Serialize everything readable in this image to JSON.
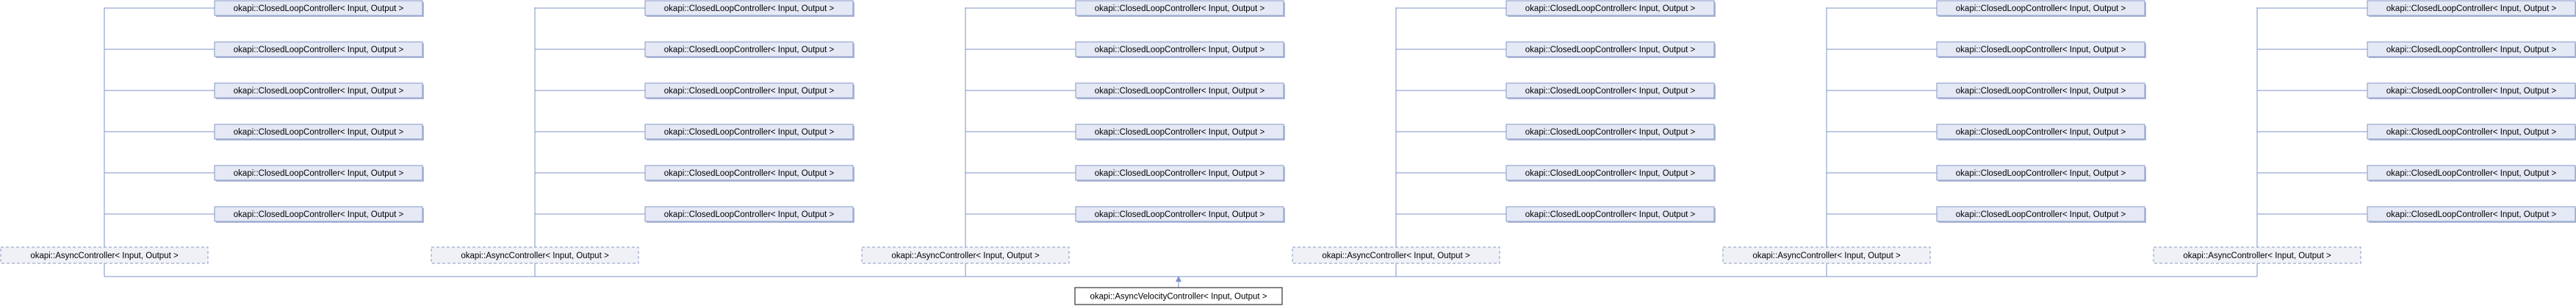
{
  "diagram": {
    "title": "",
    "target_node": "okapi::AsyncVelocityController< Input, Output >",
    "group_count": 6,
    "groups": [
      {
        "base": "okapi::AsyncController< Input, Output >",
        "children": [
          "okapi::ClosedLoopController< Input, Output >",
          "okapi::ClosedLoopController< Input, Output >",
          "okapi::ClosedLoopController< Input, Output >",
          "okapi::ClosedLoopController< Input, Output >",
          "okapi::ClosedLoopController< Input, Output >",
          "okapi::ClosedLoopController< Input, Output >"
        ]
      },
      {
        "base": "okapi::AsyncController< Input, Output >",
        "children": [
          "okapi::ClosedLoopController< Input, Output >",
          "okapi::ClosedLoopController< Input, Output >",
          "okapi::ClosedLoopController< Input, Output >",
          "okapi::ClosedLoopController< Input, Output >",
          "okapi::ClosedLoopController< Input, Output >",
          "okapi::ClosedLoopController< Input, Output >"
        ]
      },
      {
        "base": "okapi::AsyncController< Input, Output >",
        "children": [
          "okapi::ClosedLoopController< Input, Output >",
          "okapi::ClosedLoopController< Input, Output >",
          "okapi::ClosedLoopController< Input, Output >",
          "okapi::ClosedLoopController< Input, Output >",
          "okapi::ClosedLoopController< Input, Output >",
          "okapi::ClosedLoopController< Input, Output >"
        ]
      },
      {
        "base": "okapi::AsyncController< Input, Output >",
        "children": [
          "okapi::ClosedLoopController< Input, Output >",
          "okapi::ClosedLoopController< Input, Output >",
          "okapi::ClosedLoopController< Input, Output >",
          "okapi::ClosedLoopController< Input, Output >",
          "okapi::ClosedLoopController< Input, Output >",
          "okapi::ClosedLoopController< Input, Output >"
        ]
      },
      {
        "base": "okapi::AsyncController< Input, Output >",
        "children": [
          "okapi::ClosedLoopController< Input, Output >",
          "okapi::ClosedLoopController< Input, Output >",
          "okapi::ClosedLoopController< Input, Output >",
          "okapi::ClosedLoopController< Input, Output >",
          "okapi::ClosedLoopController< Input, Output >",
          "okapi::ClosedLoopController< Input, Output >"
        ]
      },
      {
        "base": "okapi::AsyncController< Input, Output >",
        "children": [
          "okapi::ClosedLoopController< Input, Output >",
          "okapi::ClosedLoopController< Input, Output >",
          "okapi::ClosedLoopController< Input, Output >",
          "okapi::ClosedLoopController< Input, Output >",
          "okapi::ClosedLoopController< Input, Output >",
          "okapi::ClosedLoopController< Input, Output >"
        ]
      }
    ],
    "colors": {
      "closed_fill": "#e4e9f5",
      "closed_border": "#8497c7",
      "async_fill": "#eff1f7",
      "async_border": "#8a99c2",
      "edge": "#7d93c7",
      "target_border": "#333333"
    }
  }
}
